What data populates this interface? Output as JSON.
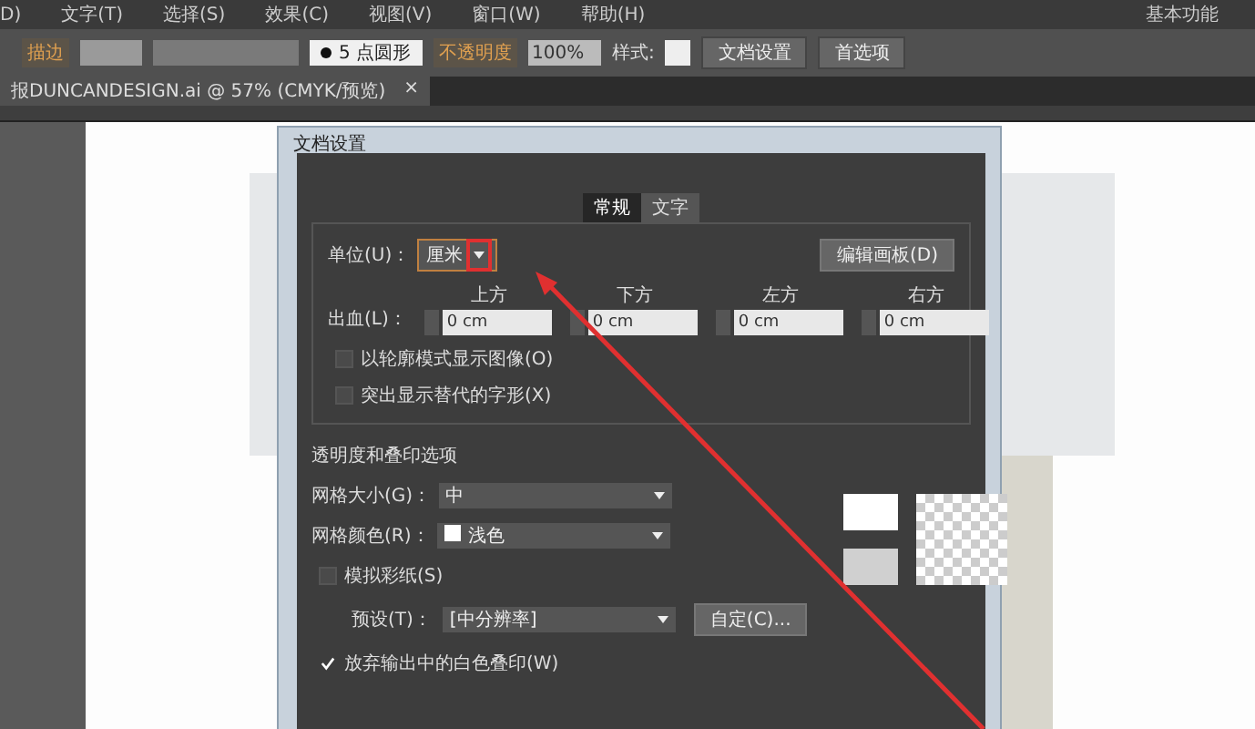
{
  "menubar": {
    "items": [
      "D)",
      "文字(T)",
      "选择(S)",
      "效果(C)",
      "视图(V)",
      "窗口(W)",
      "帮助(H)"
    ],
    "workspace": "基本功能"
  },
  "control_bar": {
    "stroke_label": "描边",
    "brush": "5 点圆形",
    "opacity_label": "不透明度",
    "opacity": "100%",
    "style_label": "样式:",
    "buttons": [
      "文档设置",
      "首选项"
    ]
  },
  "document_tab": {
    "title": "报DUNCANDESIGN.ai @ 57% (CMYK/预览)",
    "close": "×"
  },
  "dialog": {
    "title": "文档设置",
    "tabs": [
      {
        "label": "常规",
        "selected": true
      },
      {
        "label": "文字",
        "selected": false
      }
    ],
    "units_label": "单位(U)：",
    "units_value": "厘米",
    "units_caret_highlighted": true,
    "edit_artboards": "编辑画板(D)",
    "bleed_label": "出血(L)：",
    "bleed": [
      {
        "label": "上方",
        "value": "0 cm"
      },
      {
        "label": "下方",
        "value": "0 cm"
      },
      {
        "label": "左方",
        "value": "0 cm"
      },
      {
        "label": "右方",
        "value": "0 cm"
      }
    ],
    "options": [
      {
        "label": "以轮廓模式显示图像(O)",
        "checked": false
      },
      {
        "label": "突出显示替代的字形(X)",
        "checked": false
      }
    ],
    "section_title": "透明度和叠印选项",
    "grid_size_label": "网格大小(G)：",
    "grid_size": "中",
    "grid_color_label": "网格颜色(R)：",
    "grid_color": "浅色",
    "simulate_paper": {
      "label": "模拟彩纸(S)",
      "checked": false
    },
    "preset_label": "预设(T)：",
    "preset": "[中分辨率]",
    "custom_button": "自定(C)...",
    "discard_white": {
      "label": "放弃输出中的白色叠印(W)",
      "checked": true
    }
  }
}
